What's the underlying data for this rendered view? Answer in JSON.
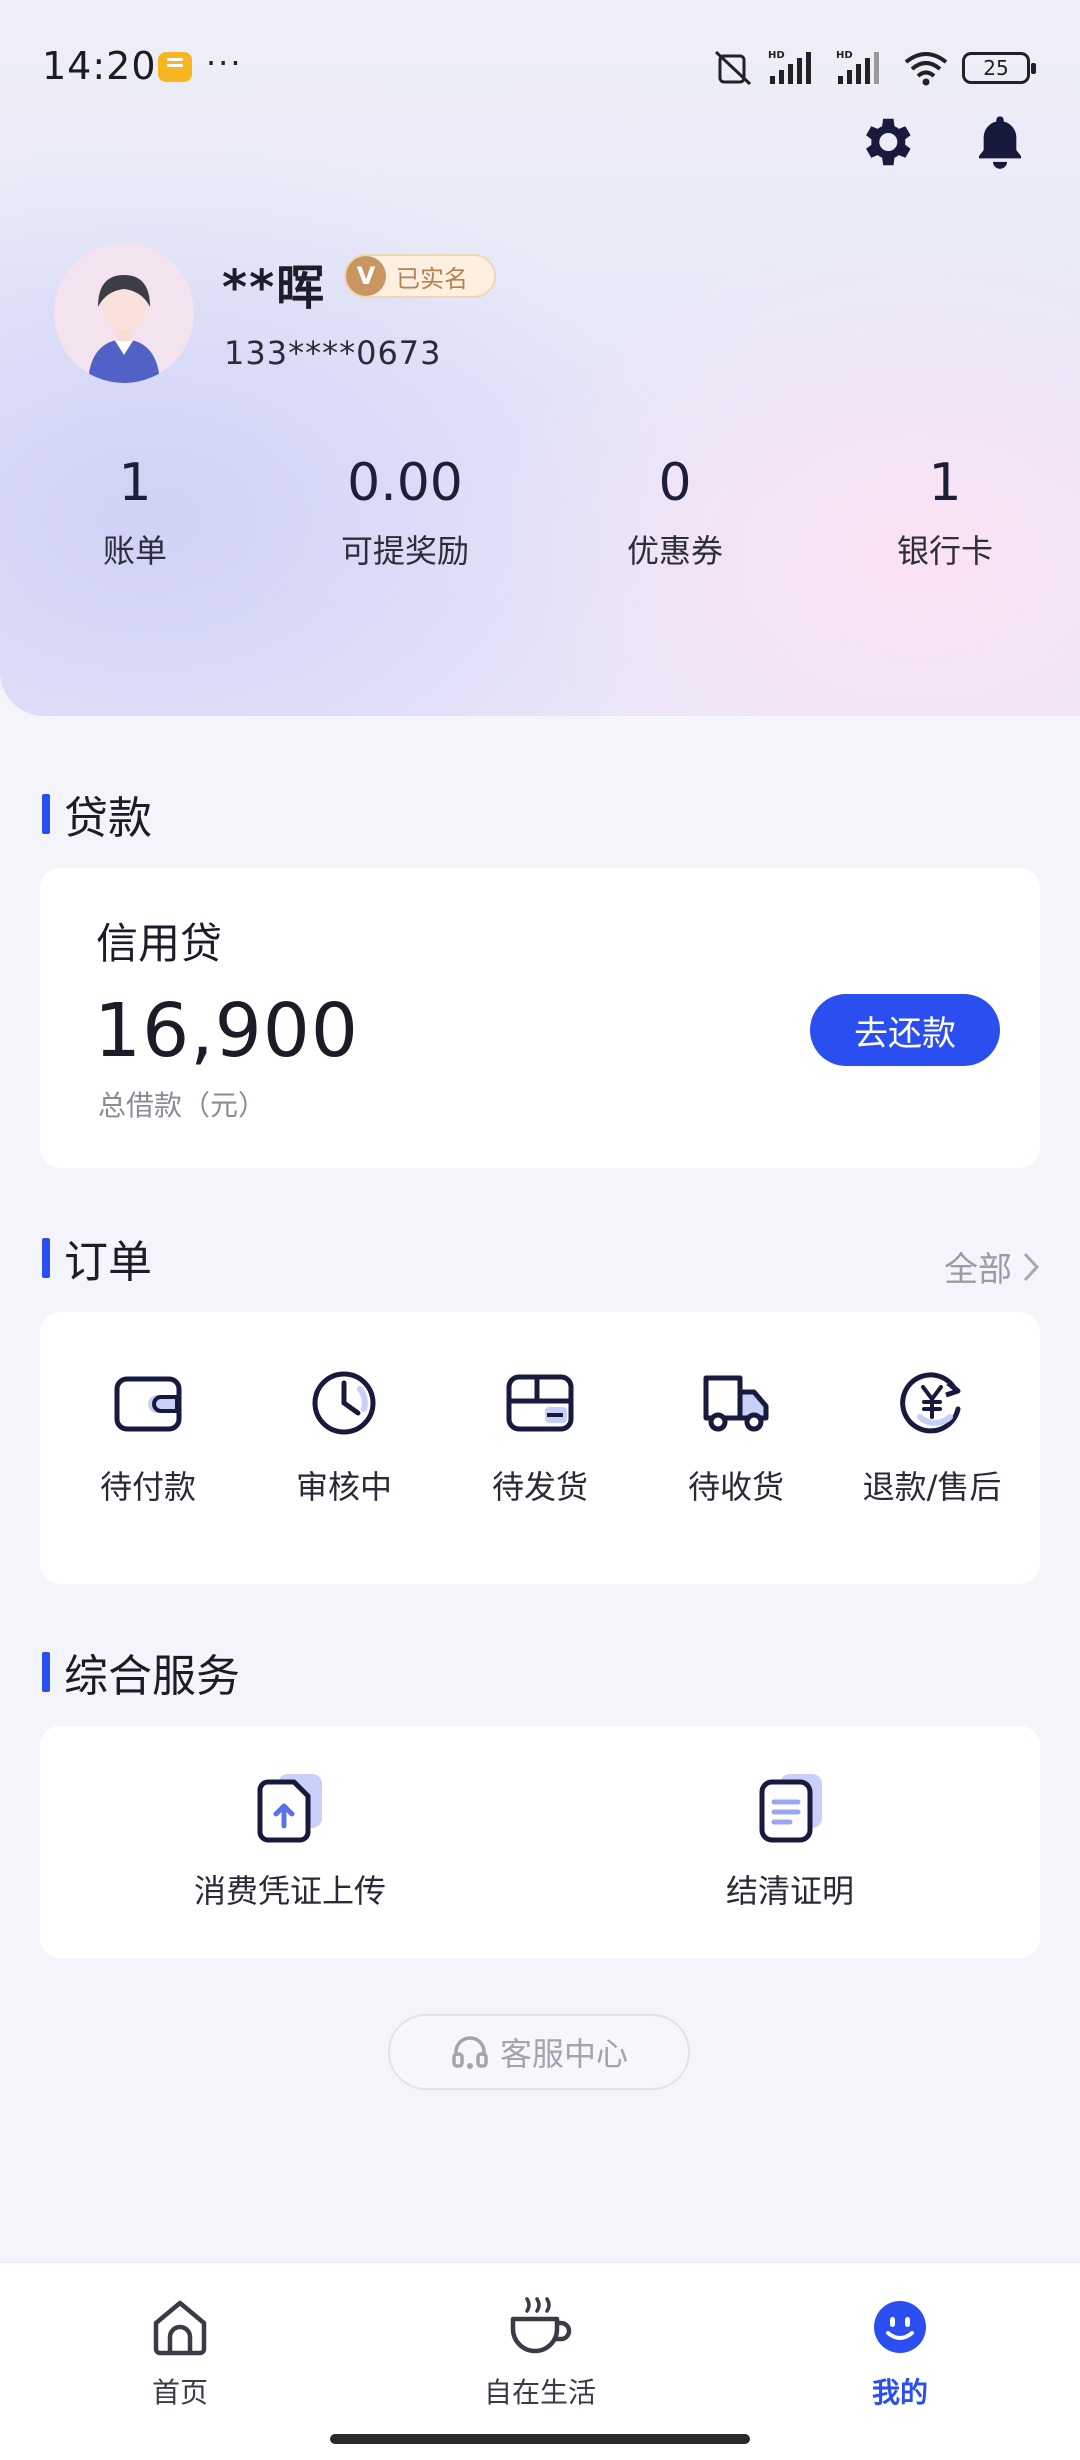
{
  "status_bar": {
    "time": "14:20",
    "dots": "···",
    "battery": "25"
  },
  "profile": {
    "name": "**晖",
    "verified_label": "已实名",
    "verified_badge": "V",
    "phone": "133****0673"
  },
  "stats": [
    {
      "value": "1",
      "label": "账单"
    },
    {
      "value": "0.00",
      "label": "可提奖励"
    },
    {
      "value": "0",
      "label": "优惠券"
    },
    {
      "value": "1",
      "label": "银行卡"
    }
  ],
  "loan_section": {
    "title": "贷款",
    "card_title": "信用贷",
    "amount": "16,900",
    "amount_label": "总借款（元）",
    "repay_button": "去还款"
  },
  "order_section": {
    "title": "订单",
    "view_all": "全部",
    "items": [
      {
        "label": "待付款",
        "icon": "wallet-icon"
      },
      {
        "label": "审核中",
        "icon": "clock-icon"
      },
      {
        "label": "待发货",
        "icon": "package-icon"
      },
      {
        "label": "待收货",
        "icon": "truck-icon"
      },
      {
        "label": "退款/售后",
        "icon": "refund-icon"
      }
    ]
  },
  "service_section": {
    "title": "综合服务",
    "items": [
      {
        "label": "消费凭证上传",
        "icon": "upload-document-icon"
      },
      {
        "label": "结清证明",
        "icon": "certificate-icon"
      }
    ]
  },
  "customer_service": {
    "label": "客服中心"
  },
  "tabbar": {
    "items": [
      {
        "label": "首页",
        "icon": "home-icon"
      },
      {
        "label": "自在生活",
        "icon": "coffee-cup-icon"
      },
      {
        "label": "我的",
        "icon": "smiley-icon"
      }
    ],
    "active_index": 2
  },
  "colors": {
    "accent": "#2a4ef0",
    "badge_bg": "#fdf0e0",
    "badge_text": "#b48150",
    "icon_dark": "#171a3d",
    "icon_light": "#c8cff8"
  }
}
